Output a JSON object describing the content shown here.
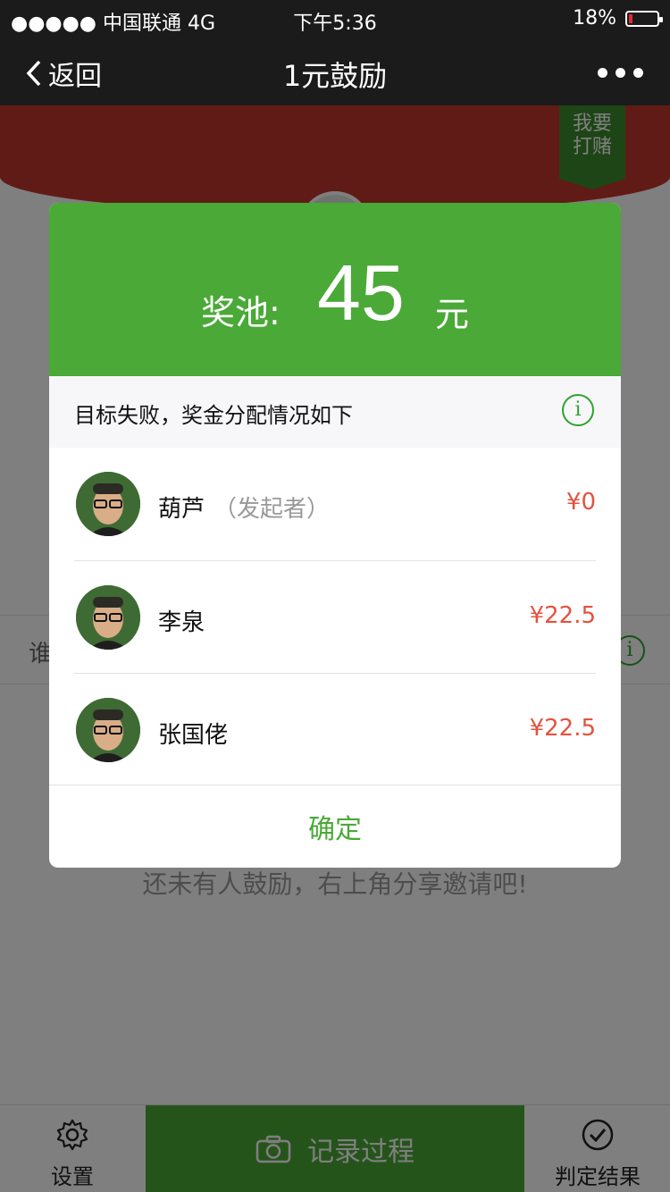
{
  "status_bar": {
    "carrier": "●●●●● 中国联通  4G",
    "time": "下午5:36",
    "battery": "18%"
  },
  "nav": {
    "back_label": "返回",
    "title": "1元鼓励"
  },
  "background": {
    "bet_badge": "我要\n打赌",
    "who_label": "谁",
    "empty_text": "还未有人鼓励，右上角分享邀请吧!",
    "tabs": {
      "settings": "设置",
      "record": "记录过程",
      "judge": "判定结果"
    }
  },
  "modal": {
    "pool_label": "奖池:",
    "pool_value": "45",
    "pool_unit": "元",
    "subtitle": "目标失败，奖金分配情况如下",
    "items": [
      {
        "name": "葫芦",
        "tag": "（发起者）",
        "amount": "¥0"
      },
      {
        "name": "李泉",
        "tag": "",
        "amount": "¥22.5"
      },
      {
        "name": "张国佬",
        "tag": "",
        "amount": "¥22.5"
      }
    ],
    "confirm_label": "确定"
  },
  "colors": {
    "accent_green": "#4aa937",
    "amount_red": "#e4523f",
    "hero_red": "#c2362f"
  }
}
